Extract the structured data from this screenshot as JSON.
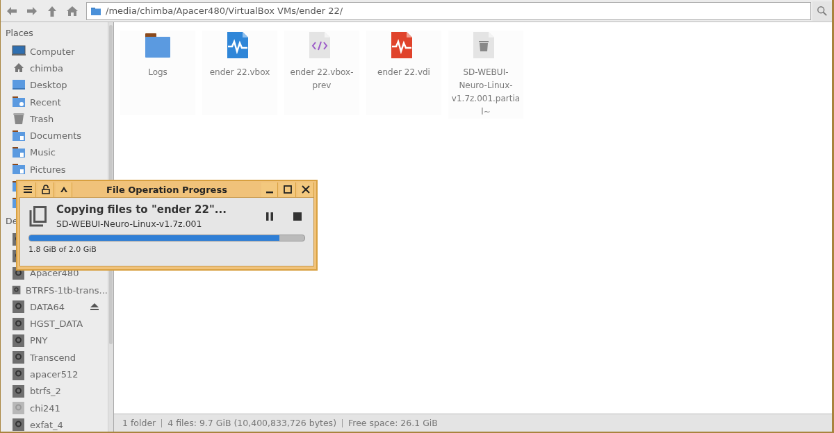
{
  "toolbar": {
    "buttons": [
      {
        "kind": "back"
      },
      {
        "kind": "forward"
      },
      {
        "kind": "up"
      },
      {
        "kind": "home"
      }
    ],
    "path": "/media/chimba/Apacer480/VirtualBox VMs/ender 22/"
  },
  "sidebar": {
    "sections": [
      {
        "heading": "Places",
        "items": [
          {
            "kind": "computer",
            "label": "Computer"
          },
          {
            "kind": "home",
            "label": "chimba"
          },
          {
            "kind": "desktop",
            "label": "Desktop"
          },
          {
            "kind": "recent",
            "label": "Recent"
          },
          {
            "kind": "trash",
            "label": "Trash"
          },
          {
            "kind": "folder",
            "label": "Documents"
          },
          {
            "kind": "folder",
            "label": "Music"
          },
          {
            "kind": "folder",
            "label": "Pictures"
          },
          {
            "kind": "folder"
          },
          {
            "kind": "folder"
          }
        ]
      },
      {
        "heading": "De",
        "items": [
          {
            "kind": "drive"
          },
          {
            "kind": "drive"
          },
          {
            "kind": "drive",
            "label": "Apacer480"
          },
          {
            "kind": "drive",
            "label": "BTRFS-1tb-trans..."
          },
          {
            "kind": "drive",
            "label": "DATA64",
            "eject": true
          },
          {
            "kind": "drive",
            "label": "HGST_DATA"
          },
          {
            "kind": "drive",
            "label": "PNY"
          },
          {
            "kind": "drive",
            "label": "Transcend"
          },
          {
            "kind": "drive",
            "label": "apacer512"
          },
          {
            "kind": "drive",
            "label": "btrfs_2"
          },
          {
            "kind": "drive-dim",
            "label": "chi241"
          },
          {
            "kind": "drive",
            "label": "exfat_4"
          }
        ]
      }
    ]
  },
  "files": [
    {
      "kind": "folder",
      "name": "Logs"
    },
    {
      "kind": "vbox",
      "name": "ender 22.vbox"
    },
    {
      "kind": "code",
      "name": "ender 22.vbox-prev"
    },
    {
      "kind": "vdi",
      "name": "ender 22.vdi"
    },
    {
      "kind": "partial",
      "name": "SD-WEBUI-Neuro-Linux-v1.7z.001.partial~"
    }
  ],
  "status_bar": [
    "1 folder",
    "4 files: 9.7 GiB (10,400,833,726 bytes)",
    "Free space: 26.1 GiB"
  ],
  "dialog": {
    "title": "File Operation Progress",
    "heading": "Copying files to \"ender 22\"...",
    "file": "SD-WEBUI-Neuro-Linux-v1.7z.001",
    "level": 0.91,
    "reading": "1.8 GiB of 2.0 GiB"
  }
}
